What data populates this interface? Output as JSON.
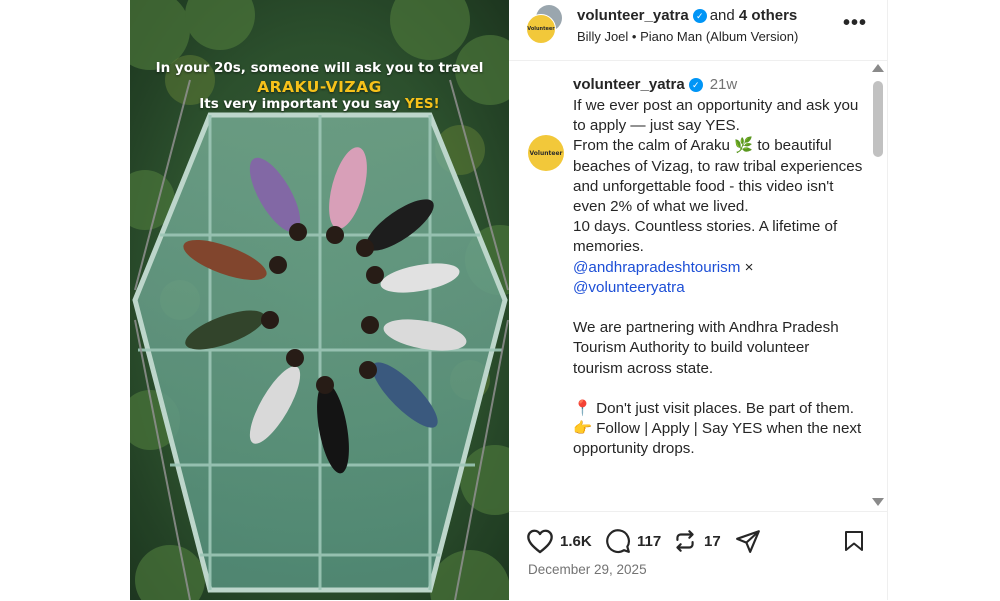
{
  "media": {
    "overlay_line1": "In your 20s, someone will ask you to travel",
    "overlay_line2": "ARAKU-VIZAG",
    "overlay_line3_prefix": "Its very important you say ",
    "overlay_line3_highlight": "YES!"
  },
  "header": {
    "username": "volunteer_yatra",
    "and_text": "and",
    "others": "4 others",
    "music": "Billy Joel • Piano Man (Album Version)",
    "avatar_text": "Volunteer"
  },
  "caption": {
    "username": "volunteer_yatra",
    "time": "21w",
    "line1": "If we ever post an opportunity and ask you to apply — just say YES.",
    "line2": "From the calm of Araku 🌿 to beautiful beaches of Vizag, to raw tribal experiences and unforgettable food - this video isn't even 2% of what we lived.",
    "line3": "10 days. Countless stories. A lifetime of memories.",
    "mention1": "@andhrapradeshtourism",
    "times": " × ",
    "mention2": "@volunteeryatra",
    "para2": "We are partnering with Andhra Pradesh Tourism Authority to build volunteer tourism across state.",
    "para3_line1": "📍 Don't just visit places. Be part of them.",
    "para3_line2": "👉 Follow | Apply | Say YES when the next opportunity drops."
  },
  "actions": {
    "likes": "1.6K",
    "comments": "117",
    "reposts": "17",
    "date": "December 29, 2025"
  },
  "colors": {
    "verified": "#0095f6",
    "overlay_accent": "#f7c21a",
    "avatar": "#f2c83a"
  }
}
